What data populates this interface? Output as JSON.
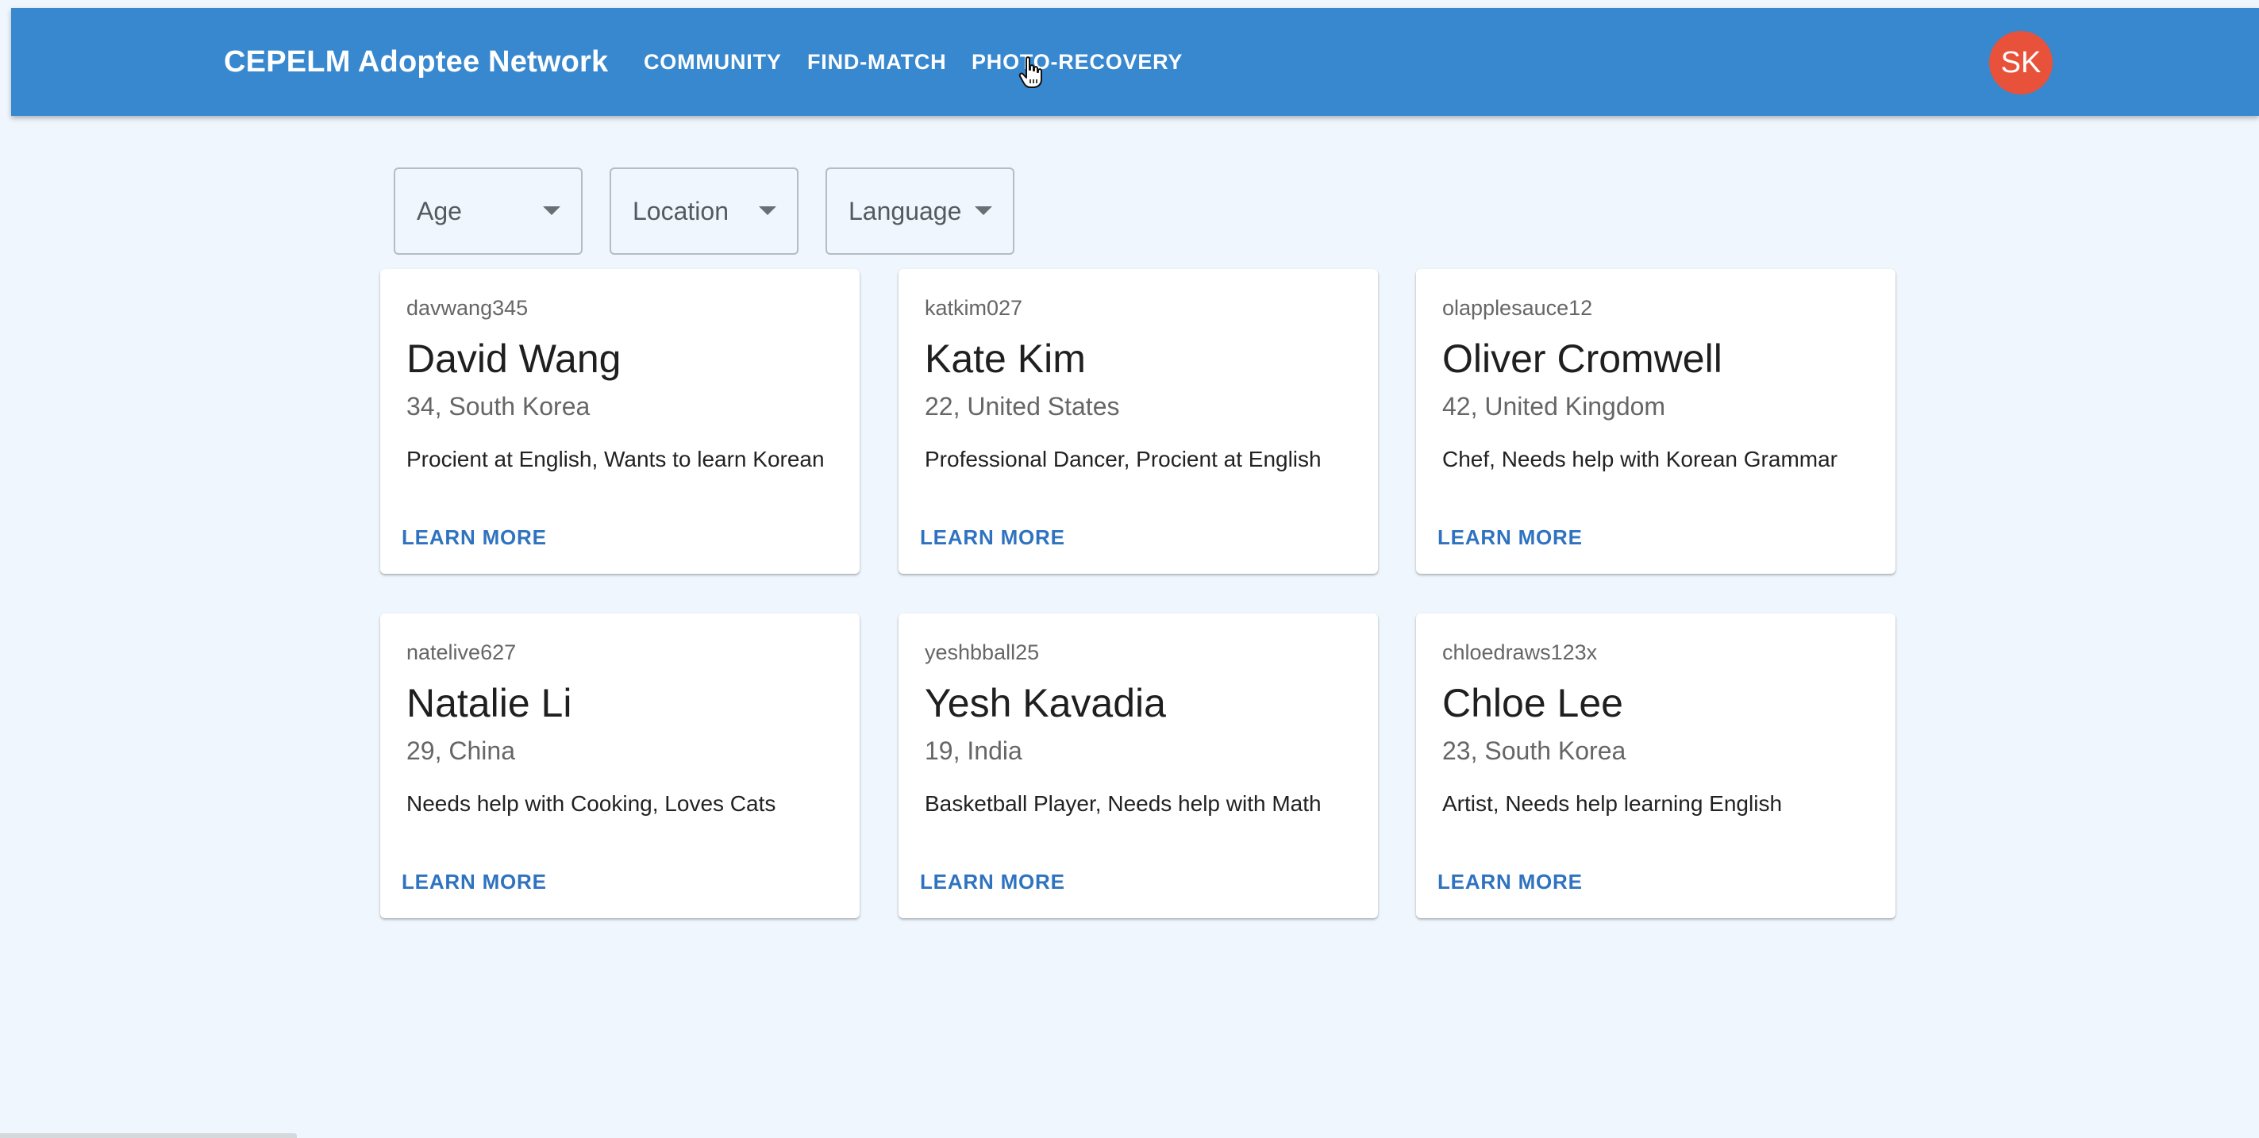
{
  "header": {
    "brand": "CEPELM Adoptee Network",
    "nav": [
      {
        "label": "COMMUNITY"
      },
      {
        "label": "FIND-MATCH"
      },
      {
        "label": "PHOTO-RECOVERY"
      }
    ],
    "avatar_initials": "SK"
  },
  "filters": [
    {
      "label": "Age"
    },
    {
      "label": "Location"
    },
    {
      "label": "Language"
    }
  ],
  "cards": [
    {
      "username": "davwang345",
      "name": "David Wang",
      "meta": "34, South Korea",
      "description": "Procient at English, Wants to learn Korean",
      "action": "LEARN MORE"
    },
    {
      "username": "katkim027",
      "name": "Kate Kim",
      "meta": "22, United States",
      "description": "Professional Dancer, Procient at English",
      "action": "LEARN MORE"
    },
    {
      "username": "olapplesauce12",
      "name": "Oliver Cromwell",
      "meta": "42, United Kingdom",
      "description": "Chef, Needs help with Korean Grammar",
      "action": "LEARN MORE"
    },
    {
      "username": "natelive627",
      "name": "Natalie Li",
      "meta": "29, China",
      "description": "Needs help with Cooking, Loves Cats",
      "action": "LEARN MORE"
    },
    {
      "username": "yeshbball25",
      "name": "Yesh Kavadia",
      "meta": "19, India",
      "description": "Basketball Player, Needs help with Math",
      "action": "LEARN MORE"
    },
    {
      "username": "chloedraws123x",
      "name": "Chloe Lee",
      "meta": "23, South Korea",
      "description": "Artist, Needs help learning English",
      "action": "LEARN MORE"
    }
  ],
  "colors": {
    "appbar": "#3888cf",
    "page_background": "#eff6fd",
    "avatar": "#e8523b",
    "link_accent": "#2f73c0"
  },
  "icons": {
    "dropdown": "caret-down-icon",
    "pointer": "hand-cursor-icon"
  }
}
